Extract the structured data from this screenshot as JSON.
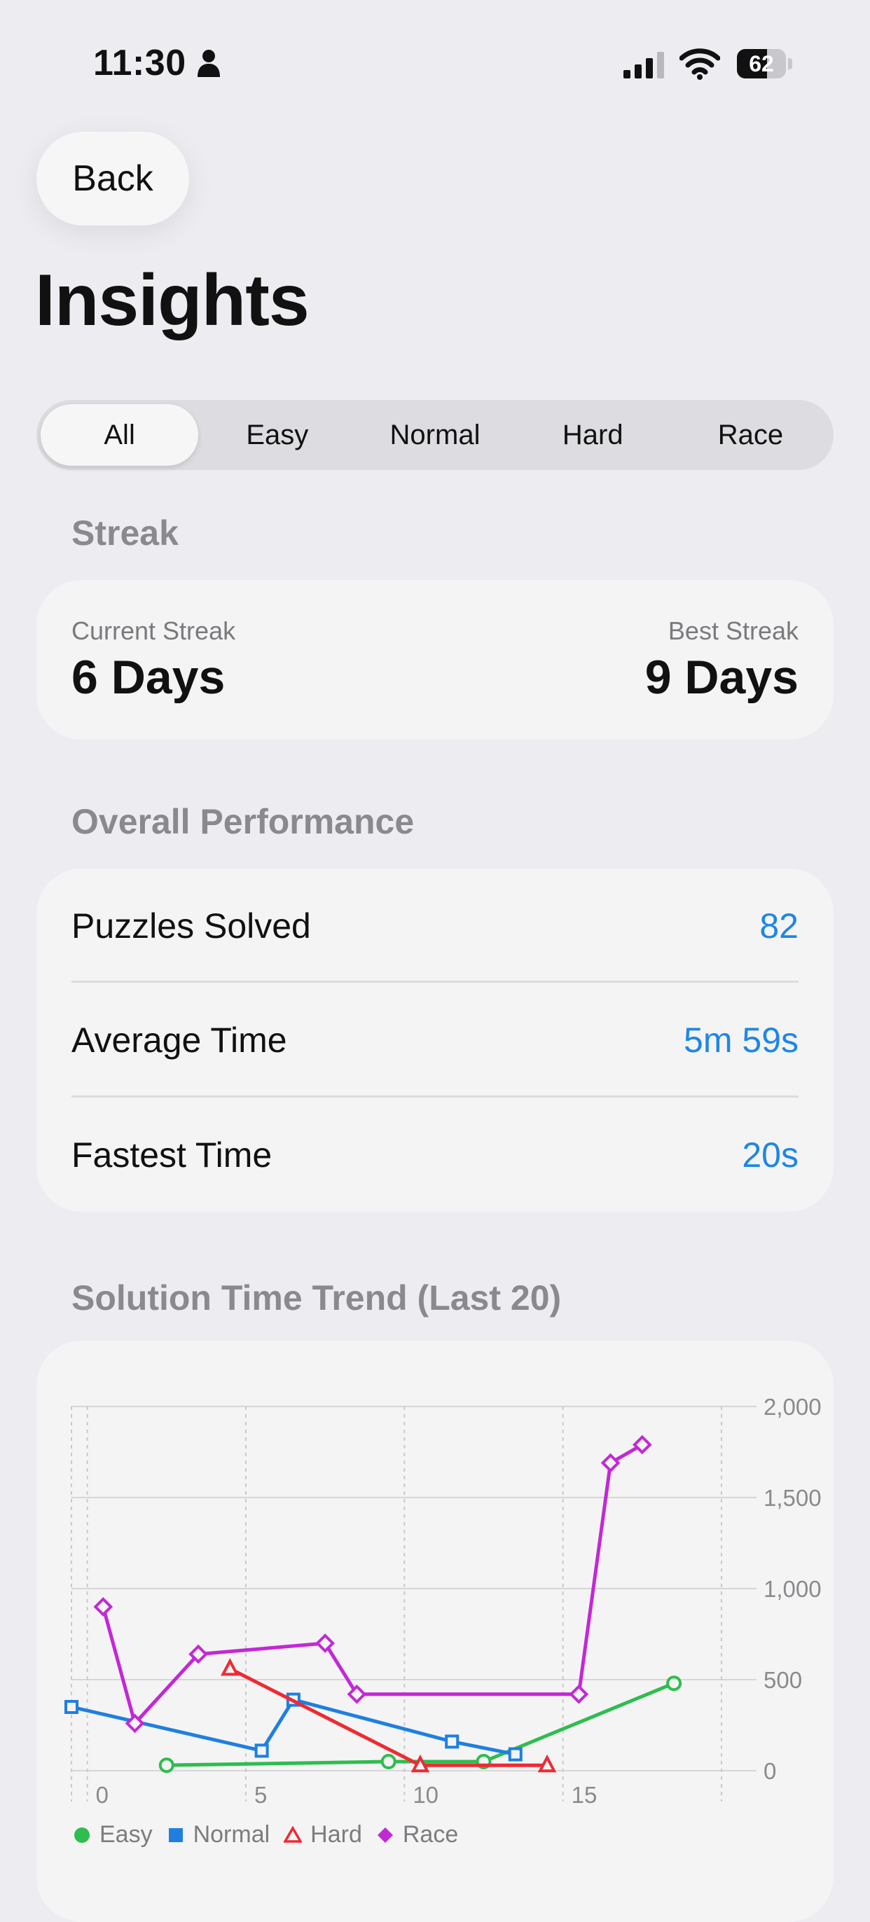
{
  "status_bar": {
    "time": "11:30",
    "battery": "62",
    "battery_level": 0.62
  },
  "nav": {
    "back_label": "Back"
  },
  "page": {
    "title": "Insights"
  },
  "tabs": [
    {
      "label": "All",
      "selected": true
    },
    {
      "label": "Easy",
      "selected": false
    },
    {
      "label": "Normal",
      "selected": false
    },
    {
      "label": "Hard",
      "selected": false
    },
    {
      "label": "Race",
      "selected": false
    }
  ],
  "streak": {
    "header": "Streak",
    "current_label": "Current Streak",
    "current_value": "6 Days",
    "best_label": "Best Streak",
    "best_value": "9 Days"
  },
  "performance": {
    "header": "Overall Performance",
    "rows": [
      {
        "label": "Puzzles Solved",
        "value": "82"
      },
      {
        "label": "Average Time",
        "value": "5m 59s"
      },
      {
        "label": "Fastest Time",
        "value": "20s"
      }
    ]
  },
  "colors": {
    "accent": "#1e86e6",
    "easy": "#2ebd4f",
    "normal": "#1f7fe0",
    "hard": "#ee2a34",
    "race": "#c328d6"
  },
  "chart_header": "Solution Time Trend (Last 20)",
  "chart_data": {
    "type": "line",
    "xlim": [
      -0.5,
      20
    ],
    "ylim": [
      0,
      2000
    ],
    "x_ticks": [
      0,
      5,
      10,
      15
    ],
    "x_tick_labels": [
      "0",
      "5",
      "10",
      "15"
    ],
    "y_ticks": [
      0,
      500,
      1000,
      1500,
      2000
    ],
    "y_tick_labels": [
      "0",
      "500",
      "1,000",
      "1,500",
      "2,000"
    ],
    "y_axis_side": "right",
    "grid": true,
    "legend_position": "bottom",
    "series": [
      {
        "name": "Easy",
        "color": "#2ebd4f",
        "marker": "circle",
        "x": [
          2.5,
          9.5,
          12.5,
          18.5
        ],
        "y": [
          30,
          50,
          50,
          480
        ]
      },
      {
        "name": "Normal",
        "color": "#1f7fe0",
        "marker": "square",
        "x": [
          -0.5,
          5.5,
          6.5,
          11.5,
          13.5
        ],
        "y": [
          350,
          110,
          390,
          160,
          90
        ]
      },
      {
        "name": "Hard",
        "color": "#ee2a34",
        "marker": "triangle",
        "x": [
          4.5,
          10.5,
          14.5
        ],
        "y": [
          560,
          30,
          30
        ]
      },
      {
        "name": "Race",
        "color": "#c328d6",
        "marker": "diamond",
        "x": [
          0.5,
          1.5,
          3.5,
          7.5,
          8.5,
          15.5,
          16.5,
          17.5
        ],
        "y": [
          900,
          260,
          640,
          700,
          420,
          420,
          1690,
          1790
        ]
      }
    ]
  }
}
